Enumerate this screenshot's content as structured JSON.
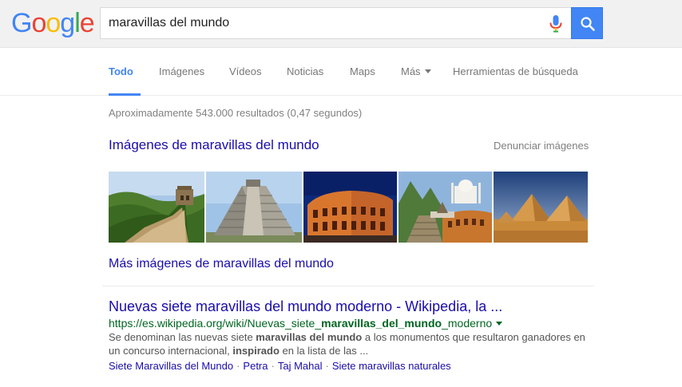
{
  "logo": {
    "text": "Google",
    "letters": [
      "G",
      "o",
      "o",
      "g",
      "l",
      "e"
    ],
    "colors": [
      "#4285f4",
      "#ea4335",
      "#fbbc05",
      "#4285f4",
      "#34a853",
      "#ea4335"
    ]
  },
  "search": {
    "query": "maravillas del mundo",
    "mic_icon": "microphone-icon",
    "search_icon": "magnifier-icon"
  },
  "tabs": [
    {
      "label": "Todo",
      "active": true
    },
    {
      "label": "Imágenes"
    },
    {
      "label": "Vídeos"
    },
    {
      "label": "Noticias"
    },
    {
      "label": "Maps"
    },
    {
      "label": "Más"
    },
    {
      "label": "Herramientas de búsqueda"
    }
  ],
  "stats": "Aproximadamente 543.000 resultados (0,47 segundos)",
  "images": {
    "heading": "Imágenes de maravillas del mundo",
    "report": "Denunciar imágenes",
    "thumbnails": [
      "Gran Muralla",
      "Chichén Itzá",
      "Coliseo",
      "Collage de maravillas",
      "Pirámides de Guiza"
    ],
    "more": "Más imágenes de maravillas del mundo"
  },
  "result": {
    "title": "Nuevas siete maravillas del mundo moderno - Wikipedia, la ...",
    "url_prefix": "https://es.wikipedia.org/wiki/Nuevas_siete_",
    "url_bold": "maravillas_del_mundo",
    "url_suffix": "_moderno",
    "snippet_1": "Se denominan las nuevas siete ",
    "snippet_bold_1": "maravillas del mundo",
    "snippet_2": " a los monumentos que resultaron ganadores en un concurso internacional, ",
    "snippet_bold_2": "inspirado",
    "snippet_3": " en la lista de las ...",
    "sitelinks": [
      "Siete Maravillas del Mundo",
      "Petra",
      "Taj Mahal",
      "Siete maravillas naturales"
    ],
    "sitelink_sep": "·"
  },
  "colors": {
    "link": "#1a0dab",
    "url": "#006621",
    "accent": "#4285f4",
    "muted": "#808080"
  }
}
